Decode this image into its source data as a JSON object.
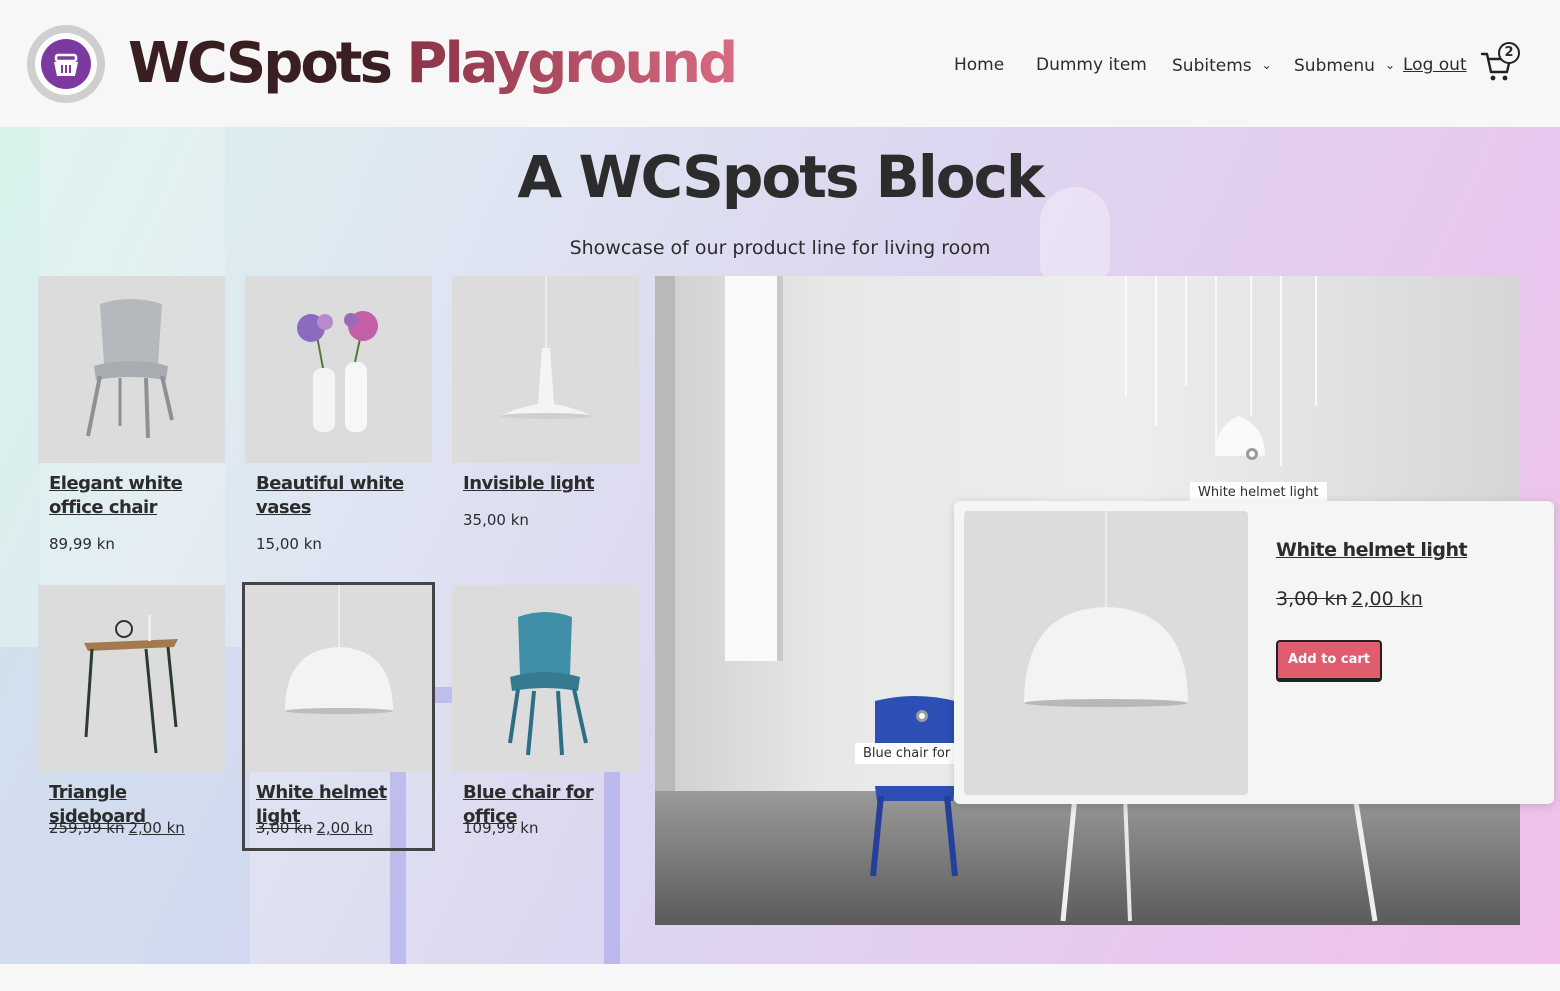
{
  "site": {
    "title_part1": "WCSpots",
    "title_part2": "Playground",
    "logo_icon": "basket-icon"
  },
  "nav": {
    "items": [
      {
        "label": "Home"
      },
      {
        "label": "Dummy item"
      },
      {
        "label": "Subitems",
        "has_submenu": true
      },
      {
        "label": "Submenu",
        "has_submenu": true
      },
      {
        "label": "Log out"
      }
    ],
    "cart_count": "2"
  },
  "block": {
    "title": "A WCSpots Block",
    "subtitle": "Showcase of our product line for living room"
  },
  "products": [
    {
      "name": "Elegant white office chair",
      "price": "89,99 kn",
      "icon": "white-chair-image"
    },
    {
      "name": "Beautiful white vases",
      "price": "15,00 kn",
      "icon": "vases-image"
    },
    {
      "name": "Invisible light",
      "price": "35,00 kn",
      "icon": "pendant-light-image"
    },
    {
      "name": "Triangle sideboard",
      "old_price": "259,99 kn",
      "price": "2,00 kn",
      "icon": "sideboard-image"
    },
    {
      "name": "White helmet light",
      "old_price": "3,00 kn",
      "price": "2,00 kn",
      "icon": "helmet-light-image",
      "selected": true
    },
    {
      "name": "Blue chair for office",
      "price": "109,99 kn",
      "icon": "blue-chair-image"
    }
  ],
  "hotspots": [
    {
      "label": "White helmet light"
    },
    {
      "label": "Blue chair for o"
    }
  ],
  "popup": {
    "name": "White helmet light",
    "old_price": "3,00 kn",
    "price": "2,00 kn",
    "button": "Add to cart"
  },
  "colors": {
    "accent": "#e05c6f",
    "logo": "#7c3aa0"
  }
}
